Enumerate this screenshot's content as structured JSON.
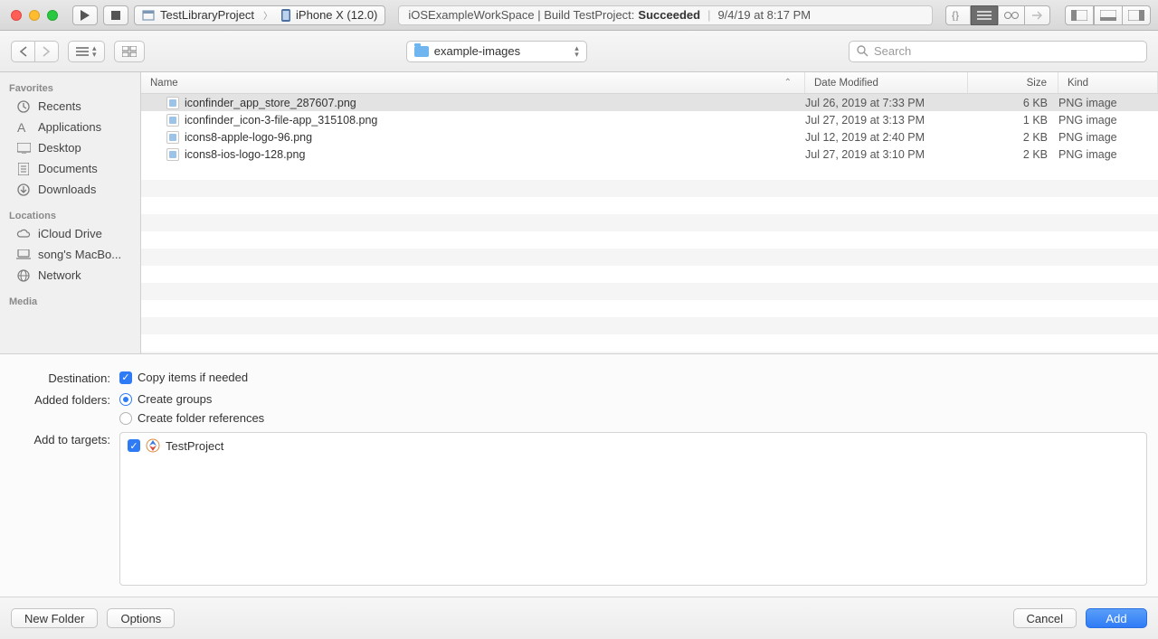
{
  "toolbar": {
    "scheme_project": "TestLibraryProject",
    "scheme_device": "iPhone X (12.0)",
    "activity_prefix": "iOSExampleWorkSpace | Build TestProject: ",
    "activity_status": "Succeeded",
    "activity_time": "9/4/19 at 8:17 PM"
  },
  "file_dialog": {
    "current_folder": "example-images",
    "search_placeholder": "Search",
    "columns": {
      "name": "Name",
      "date": "Date Modified",
      "size": "Size",
      "kind": "Kind"
    },
    "files": [
      {
        "name": "iconfinder_app_store_287607.png",
        "date": "Jul 26, 2019 at 7:33 PM",
        "size": "6 KB",
        "kind": "PNG image",
        "selected": true
      },
      {
        "name": "iconfinder_icon-3-file-app_315108.png",
        "date": "Jul 27, 2019 at 3:13 PM",
        "size": "1 KB",
        "kind": "PNG image",
        "selected": false
      },
      {
        "name": "icons8-apple-logo-96.png",
        "date": "Jul 12, 2019 at 2:40 PM",
        "size": "2 KB",
        "kind": "PNG image",
        "selected": false
      },
      {
        "name": "icons8-ios-logo-128.png",
        "date": "Jul 27, 2019 at 3:10 PM",
        "size": "2 KB",
        "kind": "PNG image",
        "selected": false
      }
    ]
  },
  "sidebar": {
    "sections": [
      {
        "title": "Favorites",
        "items": [
          "Recents",
          "Applications",
          "Desktop",
          "Documents",
          "Downloads"
        ]
      },
      {
        "title": "Locations",
        "items": [
          "iCloud Drive",
          "song's MacBo...",
          "Network"
        ]
      },
      {
        "title": "Media",
        "items": []
      }
    ]
  },
  "options": {
    "destination_label": "Destination:",
    "copy_label": "Copy items if needed",
    "added_folders_label": "Added folders:",
    "create_groups_label": "Create groups",
    "create_refs_label": "Create folder references",
    "add_targets_label": "Add to targets:",
    "target_name": "TestProject"
  },
  "buttons": {
    "new_folder": "New Folder",
    "options": "Options",
    "cancel": "Cancel",
    "add": "Add"
  }
}
